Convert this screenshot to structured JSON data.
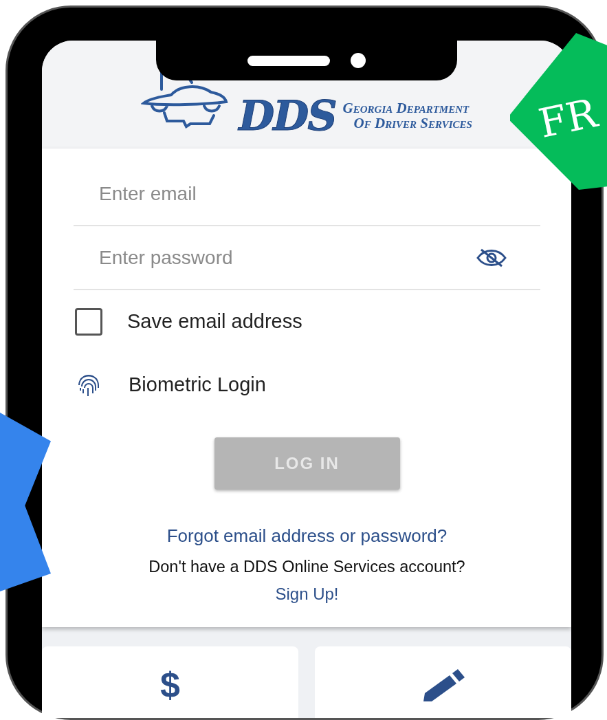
{
  "header": {
    "logo_mark": "DDS",
    "logo_line_1": "Georgia Department",
    "logo_line_2": "Of Driver Services"
  },
  "login": {
    "email": {
      "placeholder": "Enter email"
    },
    "password": {
      "placeholder": "Enter password",
      "visible": false
    },
    "save_email": {
      "label": "Save email address",
      "checked": false
    },
    "biometric": {
      "label": "Biometric Login"
    },
    "login_button": {
      "label": "LOG IN",
      "disabled": true
    },
    "forgot_link": "Forgot email address or password?",
    "signup_prompt": "Don't have a DDS Online Services account?",
    "signup_link": "Sign Up!"
  },
  "tiles": [
    {
      "kind": "symbol",
      "symbol": "$"
    },
    {
      "kind": "pencil"
    }
  ],
  "promo_badge": {
    "text": "FR"
  }
}
